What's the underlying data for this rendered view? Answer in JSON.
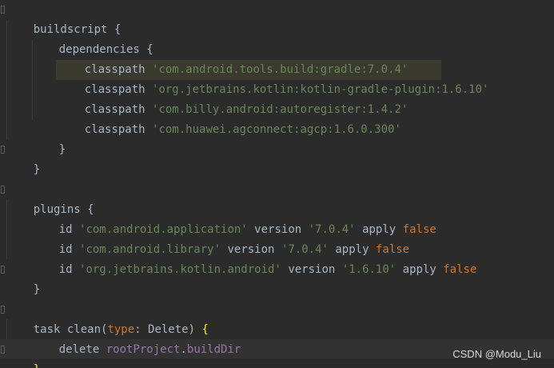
{
  "colors": {
    "background": "#2b2b2b",
    "text": "#a9b7c6",
    "keyword": "#cc7832",
    "string": "#6a8759",
    "field": "#9876aa",
    "selected_line": "#3a3a2e",
    "caret_line": "#323232"
  },
  "code": {
    "l1": "buildscript {",
    "l2": "dependencies {",
    "l3_kw": "classpath",
    "l3_str": "'com.android.tools.build:gradle:7.0.4'",
    "l4_kw": "classpath",
    "l4_str": "'org.jetbrains.kotlin:kotlin-gradle-plugin:1.6.10'",
    "l5_kw": "classpath",
    "l5_str": "'com.billy.android:autoregister:1.4.2'",
    "l6_kw": "classpath",
    "l6_str": "'com.huawei.agconnect:agcp:1.6.0.300'",
    "l7": "}",
    "l8": "}",
    "l10": "plugins {",
    "l11_id": "id",
    "l11_str": "'com.android.application'",
    "l11_ver": "version",
    "l11_verstr": "'7.0.4'",
    "l11_apply": "apply",
    "l11_false": "false",
    "l12_id": "id",
    "l12_str": "'com.android.library'",
    "l12_ver": "version",
    "l12_verstr": "'7.0.4'",
    "l12_apply": "apply",
    "l12_false": "false",
    "l13_id": "id",
    "l13_str": "'org.jetbrains.kotlin.android'",
    "l13_ver": "version",
    "l13_verstr": "'1.6.10'",
    "l13_apply": "apply",
    "l13_false": "false",
    "l14": "}",
    "l16_task": "task clean(",
    "l16_type": "type",
    "l16_rest": ": Delete) ",
    "l16_brace": "{",
    "l17_delete": "delete ",
    "l17_root": "rootProject",
    "l17_dot": ".",
    "l17_build": "buildDir",
    "l18": "}"
  },
  "watermark": "CSDN @Modu_Liu"
}
